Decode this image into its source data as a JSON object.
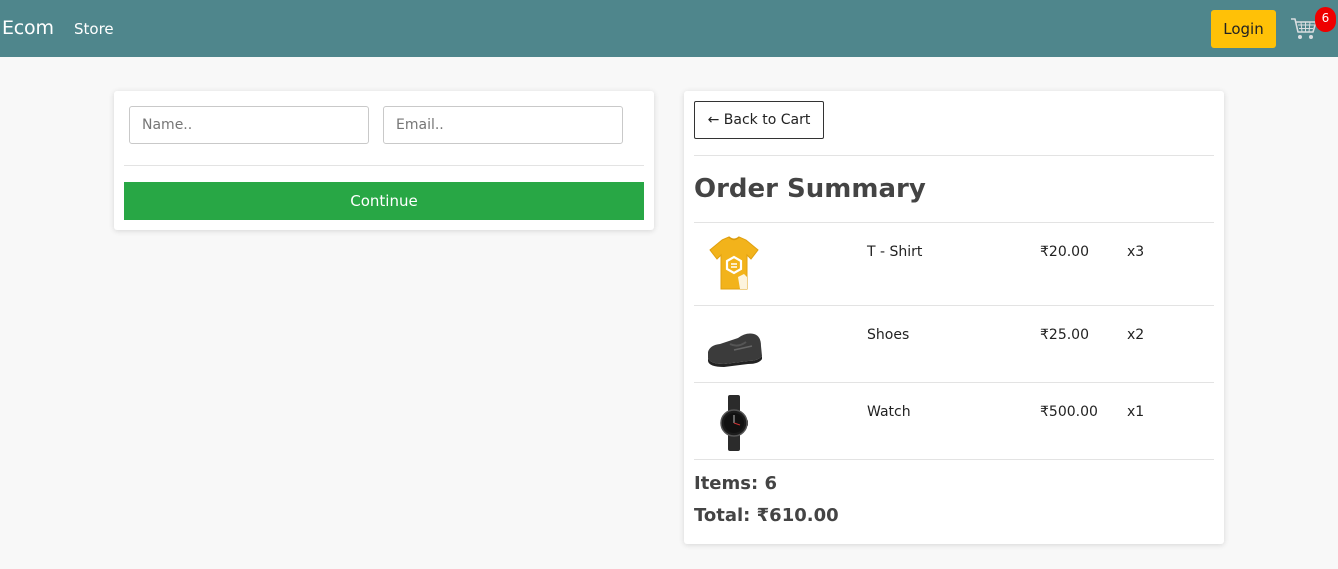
{
  "navbar": {
    "brand": "Ecom",
    "links": [
      {
        "label": "Store"
      }
    ],
    "login_label": "Login",
    "cart_count": "6"
  },
  "checkout_form": {
    "name_placeholder": "Name..",
    "email_placeholder": "Email..",
    "continue_label": "Continue"
  },
  "summary": {
    "back_label": "← Back to Cart",
    "title": "Order Summary",
    "items": [
      {
        "image": "tshirt-image",
        "name": "T - Shirt",
        "price": "₹20.00",
        "qty": "x3"
      },
      {
        "image": "shoes-image",
        "name": "Shoes",
        "price": "₹25.00",
        "qty": "x2"
      },
      {
        "image": "watch-image",
        "name": "Watch",
        "price": "₹500.00",
        "qty": "x1"
      }
    ],
    "items_text": "Items: 6",
    "total_text": "Total: ₹610.00"
  },
  "colors": {
    "navbar": "#4f868c",
    "login": "#ffc107",
    "continue": "#28a745",
    "badge": "#ee0000"
  }
}
